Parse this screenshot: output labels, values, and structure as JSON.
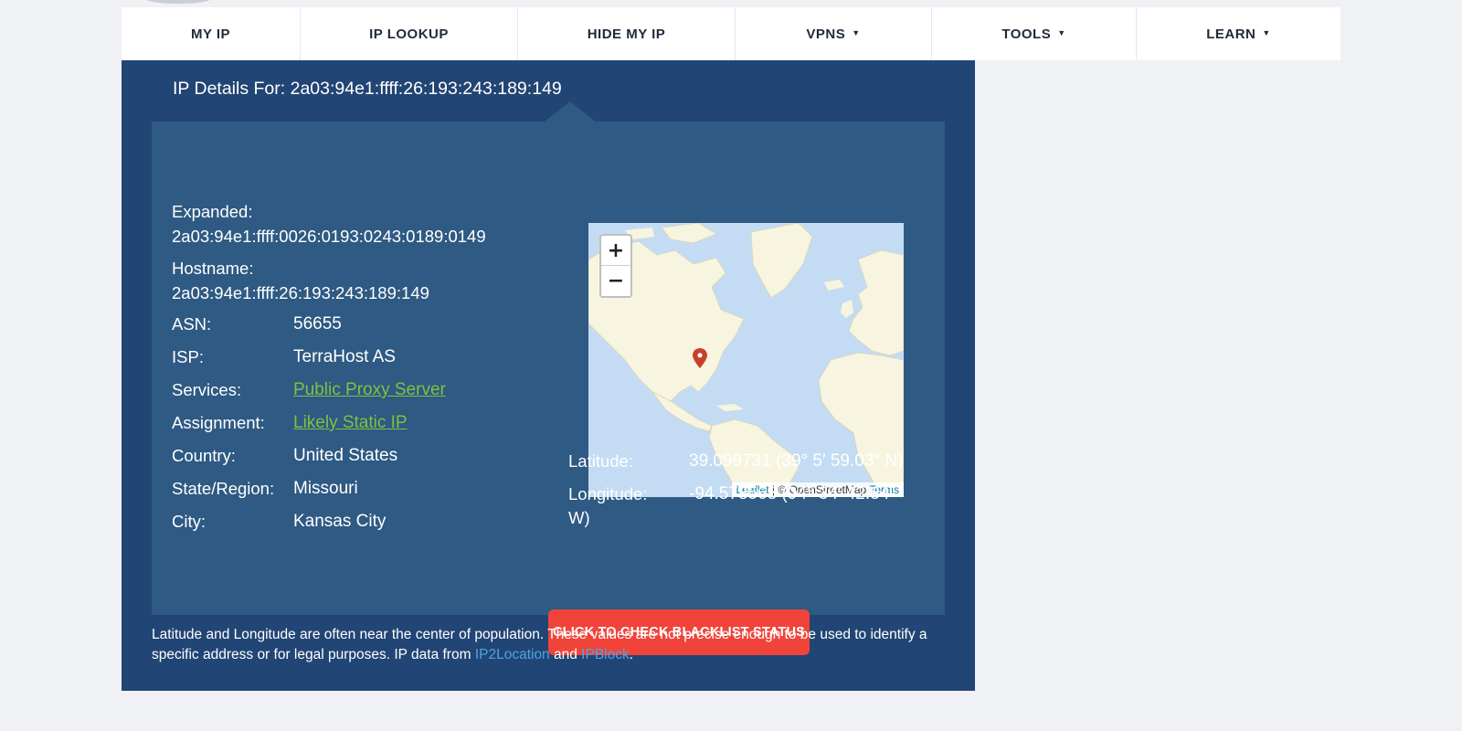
{
  "nav": {
    "items": [
      {
        "label": "MY IP",
        "dropdown": false
      },
      {
        "label": "IP LOOKUP",
        "dropdown": false
      },
      {
        "label": "HIDE MY IP",
        "dropdown": false
      },
      {
        "label": "VPNS",
        "dropdown": true
      },
      {
        "label": "TOOLS",
        "dropdown": true
      },
      {
        "label": "LEARN",
        "dropdown": true
      }
    ],
    "caret_glyph": "▼"
  },
  "details": {
    "title": "IP Details For: 2a03:94e1:ffff:26:193:243:189:149",
    "expanded_label": "Expanded:",
    "expanded_value": "2a03:94e1:ffff:0026:0193:0243:0189:0149",
    "hostname_label": "Hostname:",
    "hostname_value": "2a03:94e1:ffff:26:193:243:189:149",
    "rows": [
      {
        "label": "ASN:",
        "value": "56655"
      },
      {
        "label": "ISP:",
        "value": "TerraHost AS"
      },
      {
        "label": "Services:",
        "value": "Public Proxy Server"
      },
      {
        "label": "Assignment:",
        "value": "Likely Static IP"
      },
      {
        "label": "Country:",
        "value": "United States"
      },
      {
        "label": "State/Region:",
        "value": "Missouri"
      },
      {
        "label": "City:",
        "value": "Kansas City"
      }
    ]
  },
  "map": {
    "zoom_in": "+",
    "zoom_out": "−",
    "attribution_leaflet": "Leaflet",
    "attribution_osm": " | © OpenStreetMap ",
    "attribution_terms": "Terms",
    "marker_icon": "map-pin-icon",
    "colors": {
      "water": "#c4dcf3",
      "land": "#f7f5df",
      "marker": "#c8402a"
    }
  },
  "coords": {
    "latitude_label": "Latitude:",
    "latitude_value": "39.099731  (39° 5′ 59.03″ N)",
    "longitude_label": "Longitude:",
    "longitude_value": "-94.578568  (94° 34′ 42.84″",
    "longitude_wrap": "W)"
  },
  "blacklist_button": "CLICK TO CHECK BLACKLIST STATUS",
  "footnote": {
    "text": "Latitude and Longitude are often near the center of population. These values are not precise enough to be used to identify a specific address or for legal purposes. IP data from ",
    "link1": "IP2Location",
    "and": " and ",
    "link2": "IPBlock",
    "end": "."
  },
  "colors": {
    "panel": "#214574",
    "inner": "#2e5a83",
    "link_green": "#7dc242",
    "button_red": "#f0443a",
    "link_blue": "#4ea3e6"
  }
}
